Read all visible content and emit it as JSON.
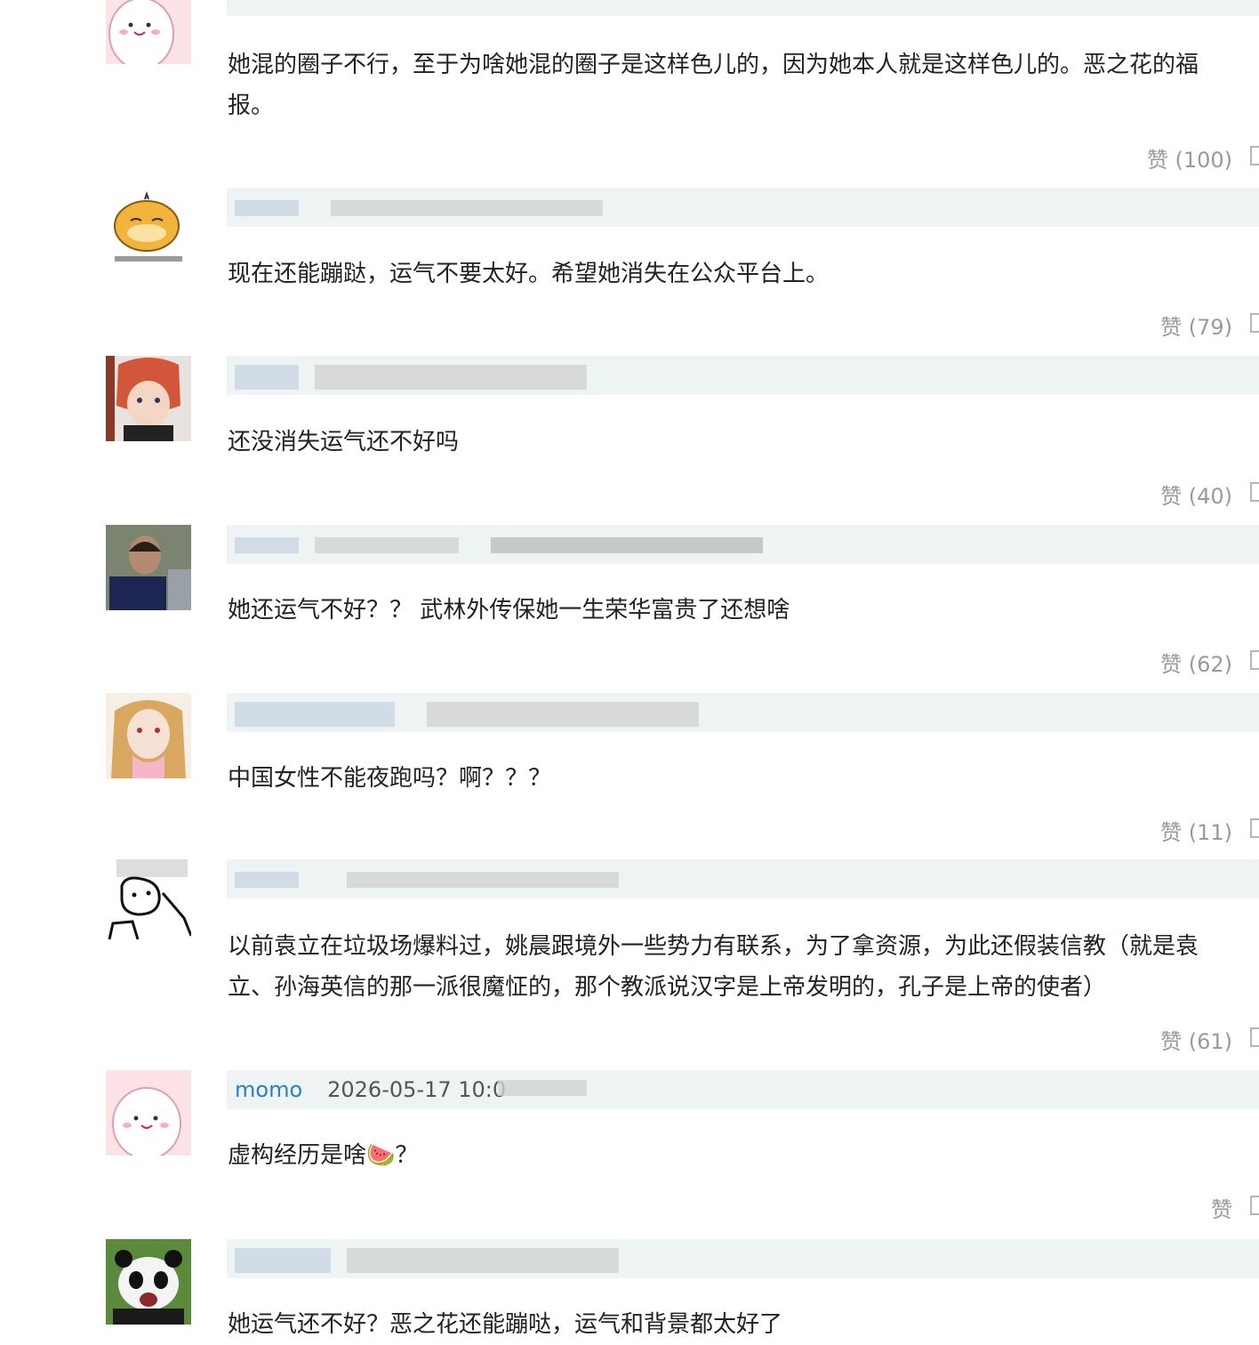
{
  "comments": [
    {
      "username": "",
      "date": "",
      "text_lines": [
        "她混的圈子不行，至于为啥她混的圈子是这样色儿的，因为她本人就是这样色儿的。恶之花的福",
        "报。"
      ],
      "like": "赞 (100)"
    },
    {
      "username": "",
      "date": "",
      "text_lines": [
        "现在还能蹦跶，运气不要太好。希望她消失在公众平台上。"
      ],
      "like": "赞 (79)"
    },
    {
      "username": "",
      "date": "",
      "text_lines": [
        "还没消失运气还不好吗"
      ],
      "like": "赞 (40)"
    },
    {
      "username": "",
      "date": "",
      "text_lines": [
        "她还运气不好？？ 武林外传保她一生荣华富贵了还想啥"
      ],
      "like": "赞 (62)"
    },
    {
      "username": "",
      "date": "",
      "text_lines": [
        "中国女性不能夜跑吗？啊？？？"
      ],
      "like": "赞 (11)"
    },
    {
      "username": "",
      "date": "",
      "text_lines": [
        "以前袁立在垃圾场爆料过，姚晨跟境外一些势力有联系，为了拿资源，为此还假装信教（就是袁",
        "立、孙海英信的那一派很魔怔的，那个教派说汉字是上帝发明的，孔子是上帝的使者）"
      ],
      "like": "赞 (61)"
    },
    {
      "username": "momo",
      "date": "2026-05-17 10:0",
      "text_lines": [
        "虚构经历是啥🍉？"
      ],
      "like": "赞"
    },
    {
      "username": "",
      "date": "",
      "text_lines": [
        "她运气还不好？恶之花还能蹦哒，运气和背景都太好了"
      ],
      "like": ""
    }
  ],
  "colors": {
    "username": "#2f7fbf",
    "meta_bar": "#eef3f3",
    "like": "#9a9a9a",
    "text": "#222222"
  },
  "icons": [
    "reply-icon"
  ]
}
